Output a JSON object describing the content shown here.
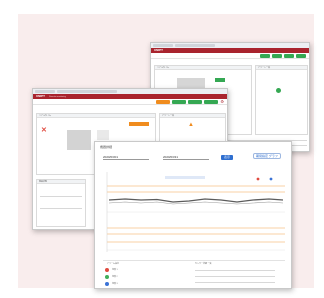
{
  "app": {
    "brand": "UNIPT",
    "subtitle": "Remote monitoring"
  },
  "colors": {
    "backdrop": "#f9eded",
    "brand_bar": "#a9242e",
    "accent_green": "#35a853",
    "accent_orange": "#f08c1e",
    "chart_orange": "#f6a24a",
    "chart_grey": "#5c5c5c",
    "chart_blue": "#3b73d6",
    "chart_red": "#e04a3f",
    "chart_green": "#3fae5a"
  },
  "back_window": {
    "section_left": "リアルタイム",
    "section_right": "アラート一覧"
  },
  "mid_window": {
    "section_left": "リアルタイム",
    "section_right": "アラート一覧",
    "section_bottom": "機器状態"
  },
  "chart_window": {
    "title": "機器詳細",
    "date_value": "2020/03/01",
    "date_value2": "2020/03/31",
    "search_button": "表示",
    "range_button": "期間指定 グラフ",
    "table_header_left": "アラーム設定",
    "table_header_right": "センサー詳細 一覧"
  },
  "legend": [
    {
      "label": "温度 1",
      "color": "#e04a3f"
    },
    {
      "label": "温度 2",
      "color": "#3fae5a"
    },
    {
      "label": "温度 3",
      "color": "#3b73d6"
    }
  ],
  "icons": {
    "alert": "x-icon",
    "warning": "warning-icon"
  }
}
